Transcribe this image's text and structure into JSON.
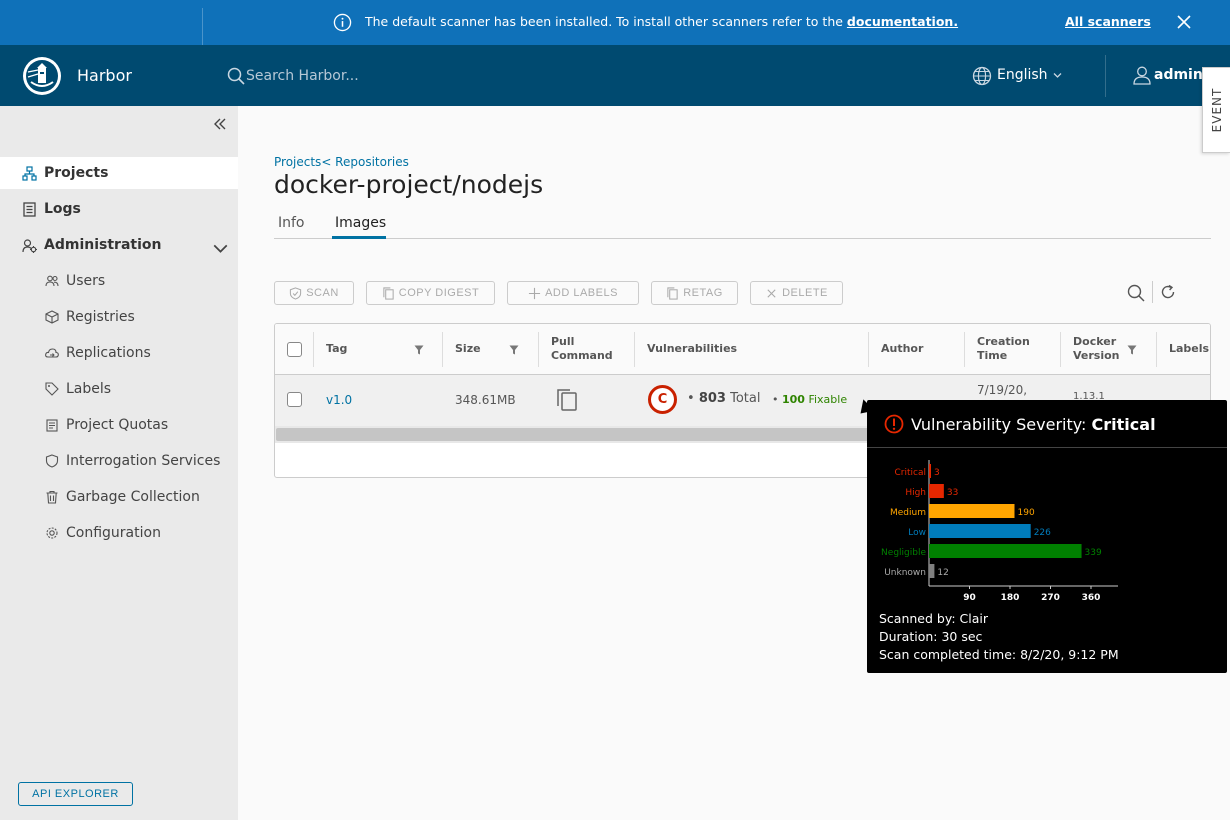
{
  "banner": {
    "message": "The default scanner has been installed. To install other scanners refer to the",
    "link": "documentation.",
    "all_scanners": "All scanners"
  },
  "header": {
    "brand": "Harbor",
    "search_placeholder": "Search Harbor...",
    "language": "English",
    "user": "admin"
  },
  "event_tab": "EVENT",
  "sidebar": {
    "items": [
      {
        "label": "Projects"
      },
      {
        "label": "Logs"
      },
      {
        "label": "Administration"
      }
    ],
    "admin_items": [
      {
        "label": "Users"
      },
      {
        "label": "Registries"
      },
      {
        "label": "Replications"
      },
      {
        "label": "Labels"
      },
      {
        "label": "Project Quotas"
      },
      {
        "label": "Interrogation Services"
      },
      {
        "label": "Garbage Collection"
      },
      {
        "label": "Configuration"
      }
    ],
    "api_explorer": "API EXPLORER"
  },
  "main": {
    "breadcrumb_projects": "Projects",
    "breadcrumb_repositories": "< Repositories",
    "title": "docker-project/nodejs",
    "tabs": [
      {
        "label": "Info"
      },
      {
        "label": "Images"
      }
    ],
    "toolbar": {
      "scan": "SCAN",
      "copy_digest": "COPY DIGEST",
      "add_labels": "ADD LABELS",
      "retag": "RETAG",
      "delete": "DELETE"
    },
    "columns": {
      "tag": "Tag",
      "size": "Size",
      "pull_line1": "Pull",
      "pull_line2": "Command",
      "vulnerabilities": "Vulnerabilities",
      "author": "Author",
      "created_line1": "Creation",
      "created_line2": "Time",
      "docker_line1": "Docker",
      "docker_line2": "Version",
      "labels": "Labels"
    },
    "row": {
      "tag": "v1.0",
      "size": "348.61MB",
      "severity_letter": "C",
      "total_count": "803",
      "total_label": "Total",
      "fixable_count": "100",
      "fixable_label": "Fixable",
      "creation_time": "7/19/20,",
      "docker_version": "1.13.1"
    }
  },
  "tooltip": {
    "title_prefix": "Vulnerability Severity: ",
    "title_severity": "Critical",
    "scanned_by": "Scanned by: Clair",
    "duration": "Duration: 30 sec",
    "completed": "Scan completed time: 8/2/20, 9:12 PM"
  },
  "chart_data": {
    "type": "bar",
    "orientation": "horizontal",
    "categories": [
      "Critical",
      "High",
      "Medium",
      "Low",
      "Negligible",
      "Unknown"
    ],
    "values": [
      3,
      33,
      190,
      226,
      339,
      12
    ],
    "colors": [
      "#e62700",
      "#e62700",
      "#ffa500",
      "#007cbb",
      "#008000",
      "#808080"
    ],
    "label_colors": [
      "#e62700",
      "#e62700",
      "#ffa500",
      "#007cbb",
      "#008000",
      "#aaaaaa"
    ],
    "x_ticks": [
      90,
      180,
      270,
      360
    ],
    "xlim": [
      0,
      420
    ],
    "grid": false
  },
  "colors": {
    "banner": "#0f71b9",
    "header": "#004a70",
    "accent": "#0072a3",
    "critical": "#c92100",
    "fixable": "#2f8400"
  }
}
